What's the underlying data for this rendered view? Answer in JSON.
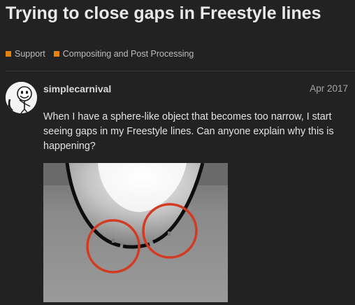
{
  "topic": {
    "title": "Trying to close gaps in Freestyle lines",
    "categories": [
      {
        "name": "Support",
        "color": "#e6820e"
      },
      {
        "name": "Compositing and Post Processing",
        "color": "#e6820e"
      }
    ]
  },
  "post": {
    "author": "simplecarnival",
    "date": "Apr 2017",
    "body": "When I have a sphere-like object that becomes too narrow, I start seeing gaps in my Freestyle lines. Can anyone explain why this is happening?",
    "avatar_icon": "cartoon-face-avatar",
    "image_icon": "render-with-gaps-image"
  },
  "colors": {
    "background": "#222222",
    "accent": "#e6820e",
    "circle_highlight": "#d23a22"
  }
}
